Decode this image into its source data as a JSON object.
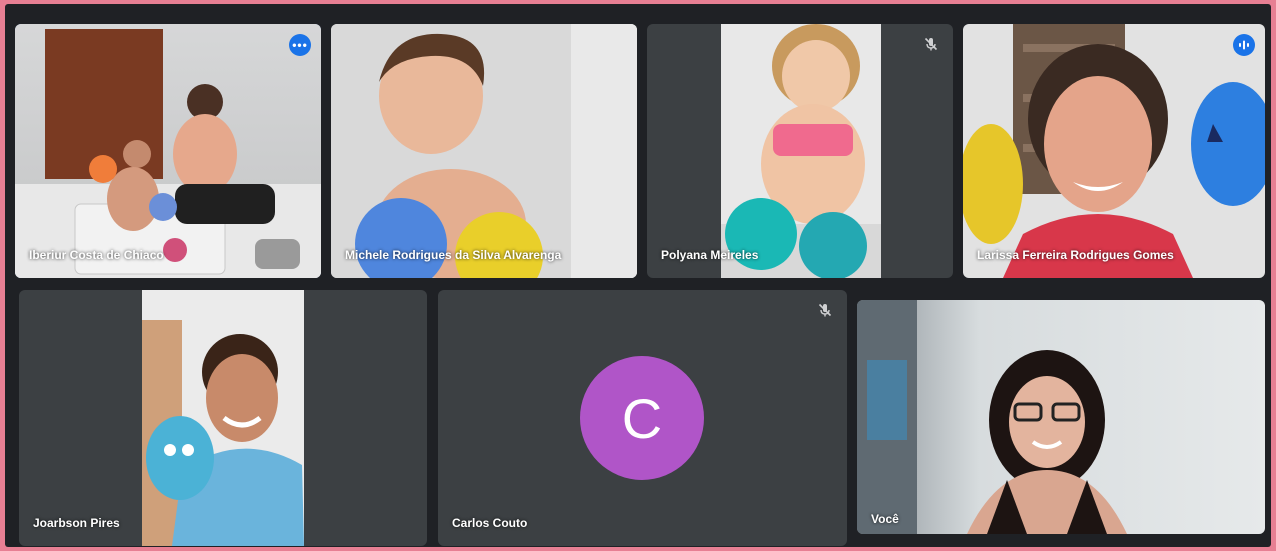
{
  "participants": [
    {
      "name": "Iberiur Costa de Chiaco",
      "icon": "more-options-icon",
      "more_label": "•••"
    },
    {
      "name": "Michele Rodrigues da Silva Alvarenga"
    },
    {
      "name": "Polyana Meireles",
      "icon": "mic-off-icon"
    },
    {
      "name": "Larissa Ferreira Rodrigues Gomes",
      "icon": "speaking-indicator-icon"
    },
    {
      "name": "Joarbson Pires"
    },
    {
      "name": "Carlos Couto",
      "avatar_letter": "C",
      "avatar_color": "#b055c8",
      "icon": "mic-off-icon"
    },
    {
      "name": "Você"
    }
  ],
  "colors": {
    "background": "#e77f93",
    "tile": "#3c4043",
    "accent": "#1a73e8",
    "active_outline": "#8ab4f8"
  }
}
